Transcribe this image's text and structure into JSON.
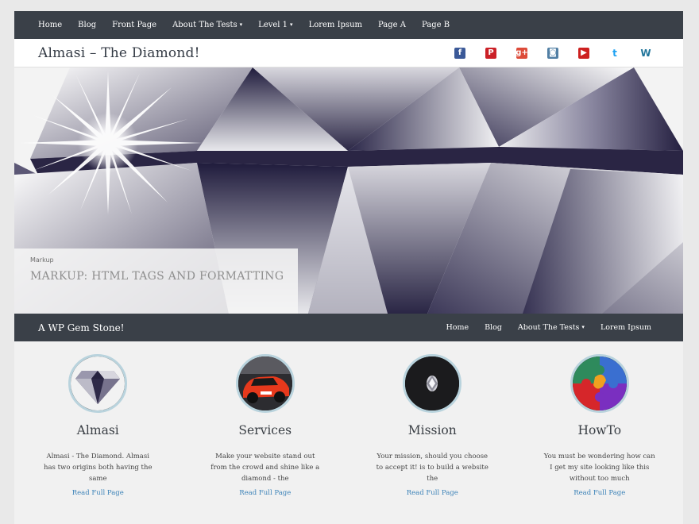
{
  "topnav": {
    "items": [
      {
        "label": "Home",
        "dropdown": false
      },
      {
        "label": "Blog",
        "dropdown": false
      },
      {
        "label": "Front Page",
        "dropdown": false
      },
      {
        "label": "About The Tests",
        "dropdown": true
      },
      {
        "label": "Level 1",
        "dropdown": true
      },
      {
        "label": "Lorem Ipsum",
        "dropdown": false
      },
      {
        "label": "Page A",
        "dropdown": false
      },
      {
        "label": "Page B",
        "dropdown": false
      }
    ],
    "caret": "▾"
  },
  "header": {
    "site_title": "Almasi – The Diamond!",
    "social": [
      {
        "name": "facebook-icon",
        "glyph": "f",
        "color": "#3b5998"
      },
      {
        "name": "pinterest-icon",
        "glyph": "P",
        "color": "#cb2027"
      },
      {
        "name": "google-plus-icon",
        "glyph": "g+",
        "color": "#dd4b39"
      },
      {
        "name": "instagram-icon",
        "glyph": "◙",
        "color": "#517fa4"
      },
      {
        "name": "youtube-icon",
        "glyph": "▶",
        "color": "#cd201f"
      },
      {
        "name": "twitter-icon",
        "glyph": "t",
        "color": "#1da1f2"
      },
      {
        "name": "wordpress-icon",
        "glyph": "W",
        "color": "#21759b"
      }
    ]
  },
  "hero": {
    "category": "Markup",
    "title": "MARKUP: HTML TAGS AND FORMATTING"
  },
  "secnav": {
    "tagline": "A WP Gem Stone!",
    "items": [
      {
        "label": "Home",
        "dropdown": false
      },
      {
        "label": "Blog",
        "dropdown": false
      },
      {
        "label": "About The Tests",
        "dropdown": true
      },
      {
        "label": "Lorem Ipsum",
        "dropdown": false
      }
    ]
  },
  "features": [
    {
      "title": "Almasi",
      "text": "Almasi - The Diamond. Almasi has two origins both having the same",
      "link": "Read Full Page",
      "image": "diamond"
    },
    {
      "title": "Services",
      "text": "Make your website stand out from the crowd and shine like a diamond - the",
      "link": "Read Full Page",
      "image": "car"
    },
    {
      "title": "Mission",
      "text": "Your mission, should you choose to accept it! is to build a website the",
      "link": "Read Full Page",
      "image": "gem"
    },
    {
      "title": "HowTo",
      "text": "You must be wondering how can I get my site looking like this without too much",
      "link": "Read Full Page",
      "image": "puzzle"
    }
  ],
  "colors": {
    "nav_bg": "#3a4048",
    "link": "#3b82b8",
    "thumb_border": "#b9d3dd"
  }
}
